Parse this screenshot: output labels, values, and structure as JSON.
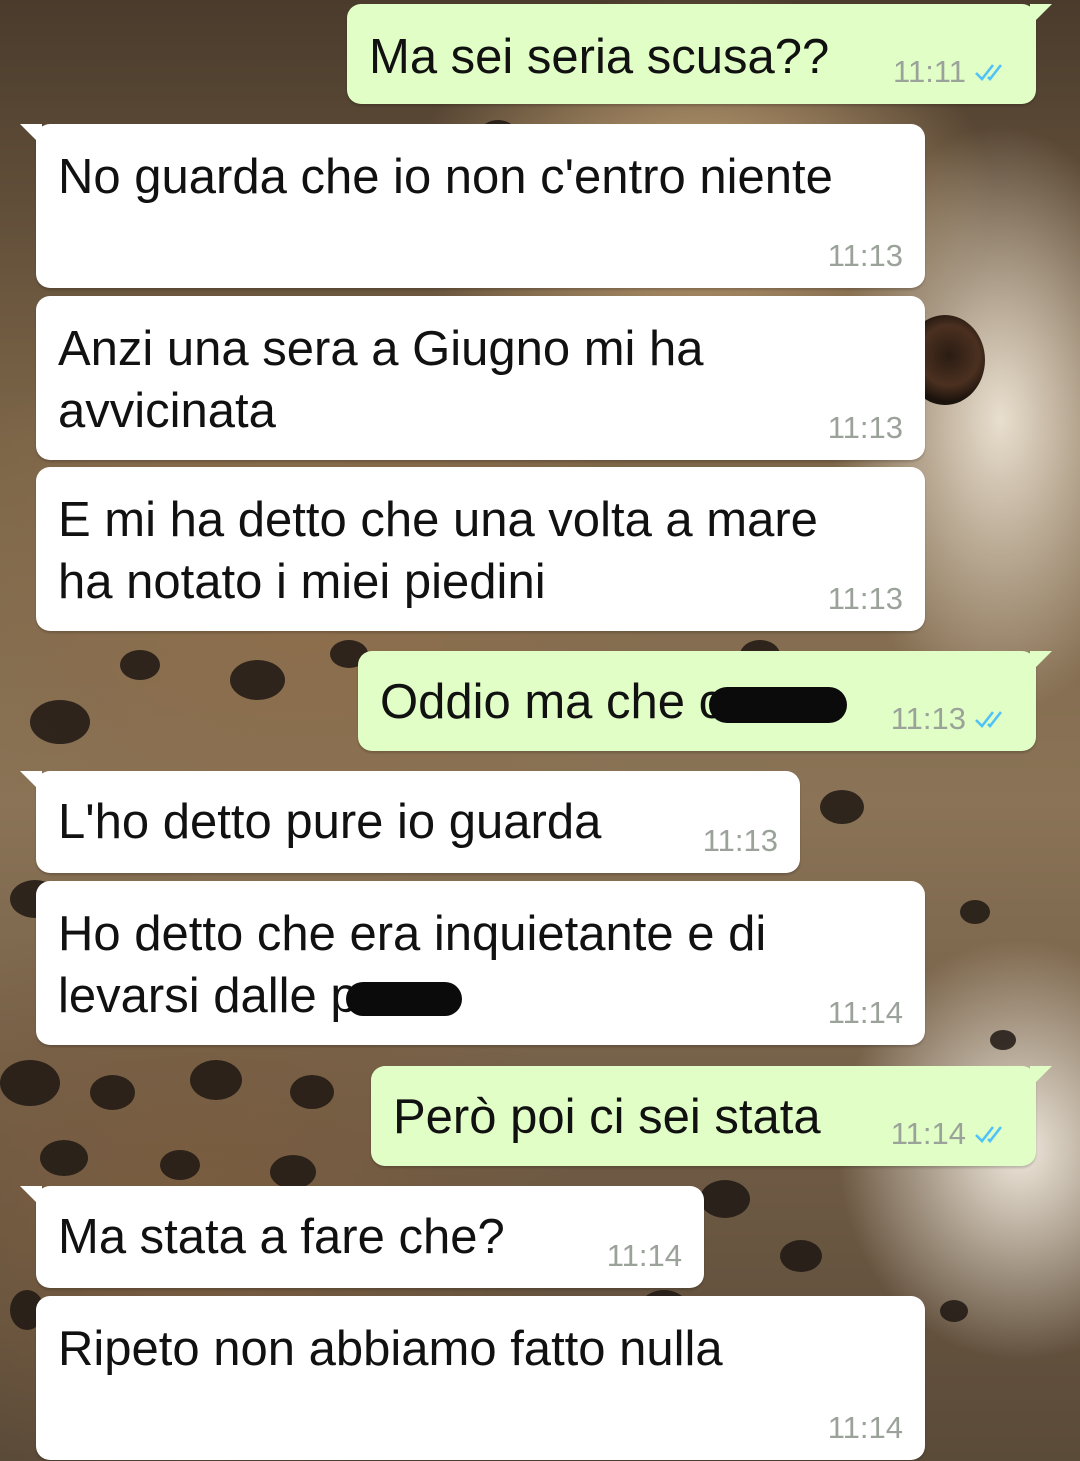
{
  "chat": {
    "messages": [
      {
        "dir": "out",
        "text": "Ma sei seria scusa??",
        "time": "11:11"
      },
      {
        "dir": "in",
        "text": "No guarda che io non c'entro niente",
        "time": "11:13"
      },
      {
        "dir": "in",
        "text": "Anzi una sera a Giugno mi ha avvicinata",
        "time": "11:13"
      },
      {
        "dir": "in",
        "text": "E mi ha detto che una volta a mare ha notato i miei piedini",
        "time": "11:13"
      },
      {
        "dir": "out",
        "text": "Oddio ma che c",
        "time": "11:13"
      },
      {
        "dir": "in",
        "text": "L'ho detto pure io guarda",
        "time": "11:13"
      },
      {
        "dir": "in",
        "text": "Ho detto che era inquietante e di levarsi dalle p",
        "time": "11:14"
      },
      {
        "dir": "out",
        "text": "Però poi ci sei stata",
        "time": "11:14"
      },
      {
        "dir": "in",
        "text": "Ma stata a fare che?",
        "time": "11:14"
      },
      {
        "dir": "in",
        "text": "Ripeto non abbiamo fatto nulla",
        "time": "11:14"
      }
    ]
  },
  "colors": {
    "incoming_bubble": "#ffffff",
    "outgoing_bubble": "#e1fec6",
    "read_ticks": "#4fc3f7",
    "timestamp": "#9aa29a"
  },
  "icons": {
    "read_receipt": "double-check-icon",
    "redaction": "censor-bar"
  }
}
